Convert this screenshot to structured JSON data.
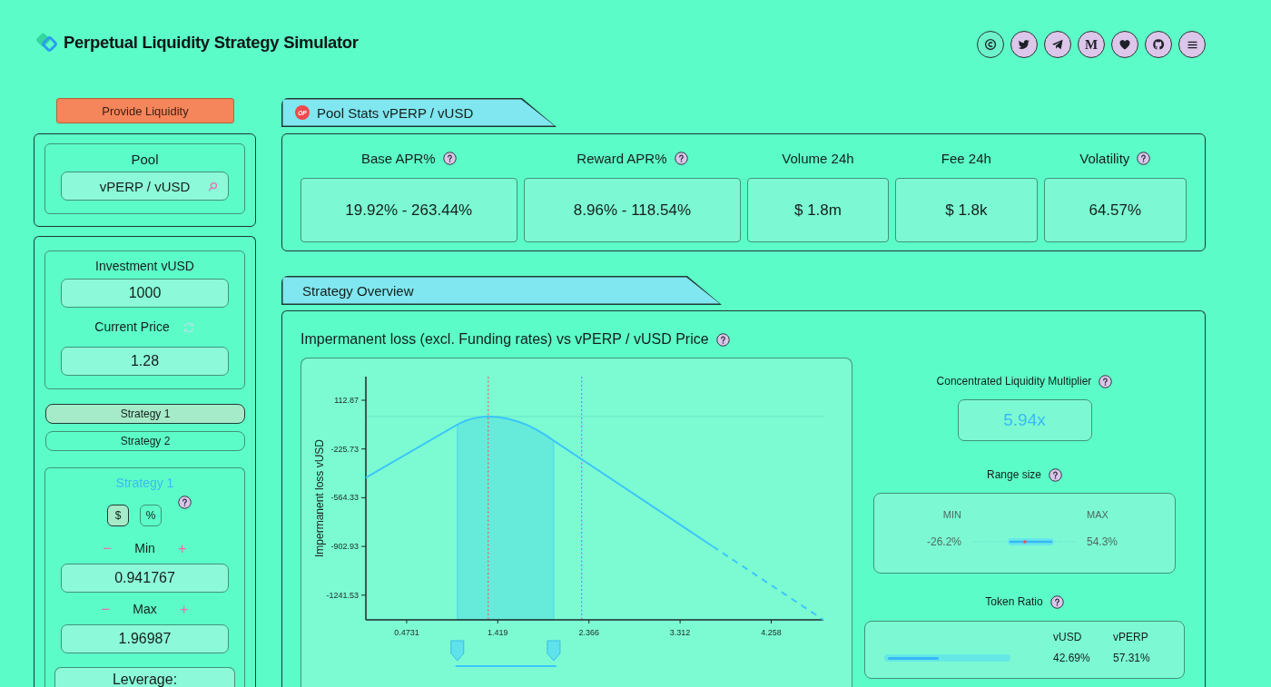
{
  "header": {
    "title": "Perpetual Liquidity Strategy Simulator",
    "letter_link": "M"
  },
  "provide_button": {
    "label": "Provide Liquidity"
  },
  "pool": {
    "label": "Pool",
    "value": "vPERP / vUSD"
  },
  "investment": {
    "label": "Investment vUSD",
    "value": "1000"
  },
  "current_price": {
    "label": "Current Price",
    "value": "1.28"
  },
  "strategy_tabs": [
    {
      "label": "Strategy 1",
      "selected": true
    },
    {
      "label": "Strategy 2",
      "selected": false
    }
  ],
  "strategy": {
    "title": "Strategy 1",
    "units": [
      {
        "label": "$",
        "selected": true
      },
      {
        "label": "%",
        "selected": false
      }
    ],
    "bounds": [
      {
        "label": "Min",
        "decrement": "−",
        "increment": "+",
        "value": "0.941767"
      },
      {
        "label": "Max",
        "decrement": "−",
        "increment": "+",
        "value": "1.96987"
      }
    ],
    "leverage": {
      "label": "Leverage:"
    }
  },
  "pool_stats": {
    "badge": "OP",
    "title": "Pool Stats vPERP / vUSD",
    "stats": [
      {
        "label": "Base APR%",
        "help": true,
        "value": "19.92% - 263.44%"
      },
      {
        "label": "Reward APR%",
        "help": true,
        "value": "8.96% - 118.54%"
      },
      {
        "label": "Volume 24h",
        "help": false,
        "value": "$ 1.8m"
      },
      {
        "label": "Fee 24h",
        "help": false,
        "value": "$ 1.8k"
      },
      {
        "label": "Volatility",
        "help": true,
        "value": "64.57%"
      }
    ]
  },
  "strategy_overview": {
    "title": "Strategy Overview",
    "chart_data": {
      "type": "line",
      "title": "Impermanent loss (excl. Funding rates) vs vPERP / vUSD Price",
      "ylabel": "Impermanent loss vUSD",
      "xlim": [
        0.05,
        4.8
      ],
      "ylim": [
        -1413,
        277
      ],
      "xticks": [
        0.4731,
        1.419,
        2.366,
        3.312,
        4.258
      ],
      "yticks": [
        112.87,
        -225.73,
        -564.33,
        -902.93,
        -1241.53
      ],
      "series": [
        {
          "color": "#3cc6f8",
          "x": [
            0.05,
            1.0,
            1.08,
            1.16,
            1.24,
            1.32,
            1.42,
            1.52,
            1.62,
            1.72,
            1.82,
            1.92,
            2.0,
            3.65
          ],
          "values": [
            -425,
            -56,
            -31,
            -14,
            -3,
            0,
            -4,
            -15,
            -33,
            -58,
            -91,
            -131,
            -168,
            -902
          ]
        },
        {
          "color": "#3cc6f8",
          "line_style": "dashed",
          "x": [
            3.65,
            4.8
          ],
          "values": [
            -902,
            -1413
          ]
        }
      ],
      "bands": [
        {
          "axis": "x",
          "from": 1.0,
          "to": 2.0,
          "color": "#66eada"
        }
      ],
      "ref_lines": [
        {
          "axis": "y",
          "value": 0,
          "color": "#6ee9c7",
          "line_style": "solid"
        },
        {
          "axis": "x",
          "value": 1.32,
          "color": "#f25c5c",
          "line_style": "dotted"
        },
        {
          "axis": "x",
          "value": 2.29,
          "color": "#c65ee0",
          "line_style": "dotted"
        }
      ]
    },
    "multiplier": {
      "label": "Concentrated Liquidity Multiplier",
      "value": "5.94x"
    },
    "range_size": {
      "label": "Range size",
      "min_label": "MIN",
      "max_label": "MAX",
      "min": "-26.2%",
      "max": "54.3%"
    },
    "token_ratio": {
      "label": "Token Ratio",
      "level": 0.4269,
      "columns": [
        {
          "name": "vUSD",
          "value": "42.69%"
        },
        {
          "name": "vPERP",
          "value": "57.31%"
        }
      ]
    }
  }
}
